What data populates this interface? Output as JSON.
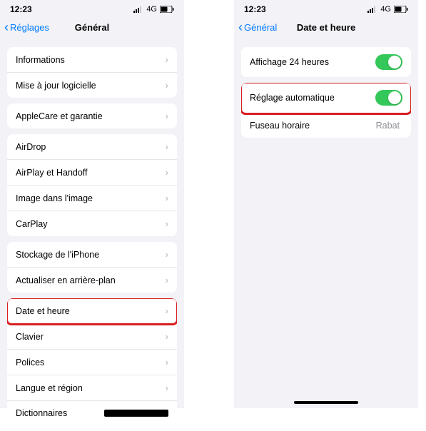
{
  "statusBar": {
    "time": "12:23",
    "network": "4G"
  },
  "left": {
    "back": "Réglages",
    "title": "Général",
    "groups": [
      [
        {
          "label": "Informations"
        },
        {
          "label": "Mise à jour logicielle"
        }
      ],
      [
        {
          "label": "AppleCare et garantie"
        }
      ],
      [
        {
          "label": "AirDrop"
        },
        {
          "label": "AirPlay et Handoff"
        },
        {
          "label": "Image dans l'image"
        },
        {
          "label": "CarPlay"
        }
      ],
      [
        {
          "label": "Stockage de l'iPhone"
        },
        {
          "label": "Actualiser en arrière-plan"
        }
      ],
      [
        {
          "label": "Date et heure",
          "highlight": true
        },
        {
          "label": "Clavier"
        },
        {
          "label": "Polices"
        },
        {
          "label": "Langue et région"
        },
        {
          "label": "Dictionnaires",
          "redactedTrailing": true
        }
      ]
    ]
  },
  "right": {
    "back": "Général",
    "title": "Date et heure",
    "groups": [
      [
        {
          "label": "Affichage 24 heures",
          "toggle": true
        }
      ],
      [
        {
          "label": "Réglage automatique",
          "toggle": true,
          "highlight": true
        },
        {
          "label": "Fuseau horaire",
          "value": "Rabat"
        }
      ]
    ]
  }
}
